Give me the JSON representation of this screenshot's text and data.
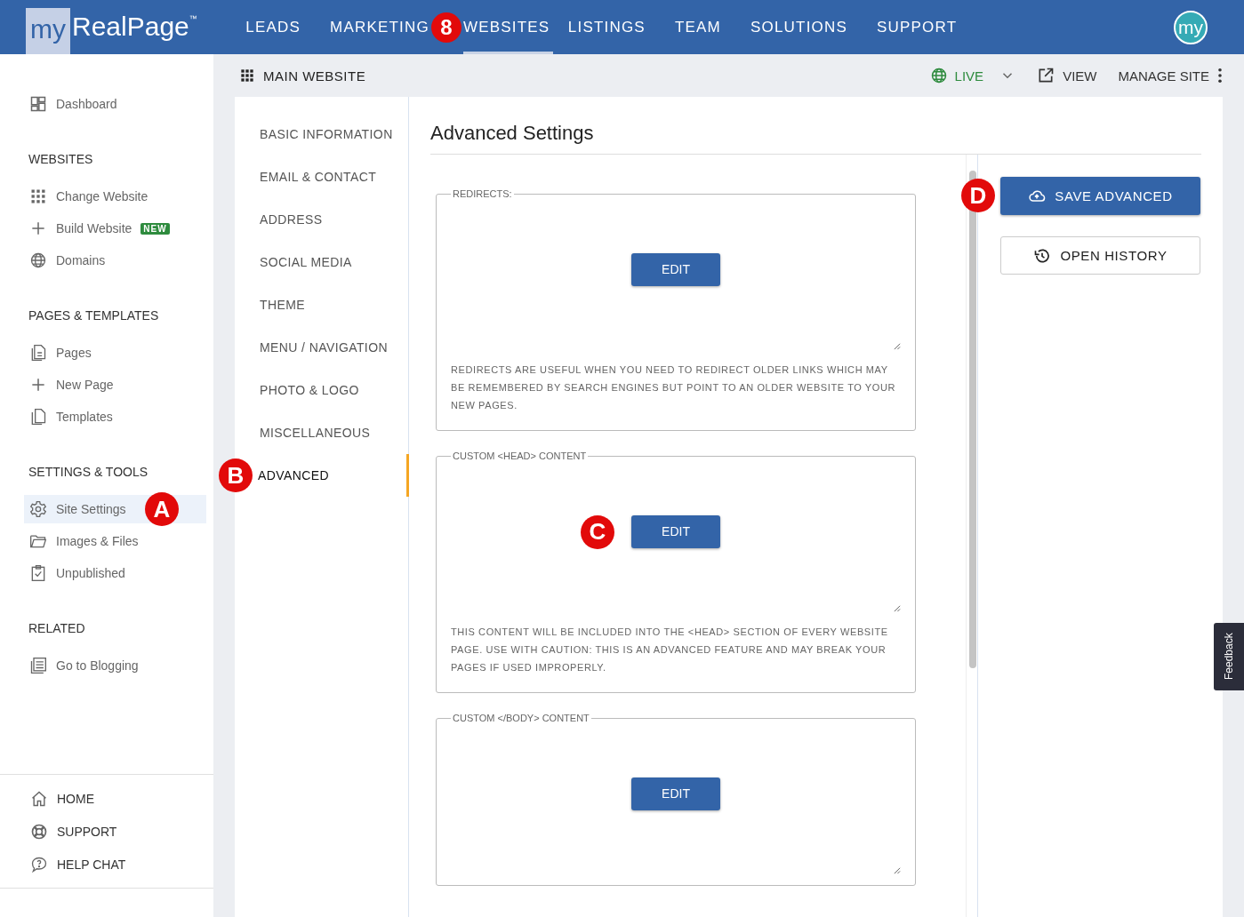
{
  "logo": {
    "prefix": "my",
    "name": "RealPage",
    "mark": "™"
  },
  "top_nav": [
    {
      "label": "LEADS",
      "selected": false
    },
    {
      "label": "MARKETING",
      "selected": false,
      "callout": "8"
    },
    {
      "label": "WEBSITES",
      "selected": true
    },
    {
      "label": "LISTINGS",
      "selected": false
    },
    {
      "label": "TEAM",
      "selected": false
    },
    {
      "label": "SOLUTIONS",
      "selected": false
    },
    {
      "label": "SUPPORT",
      "selected": false
    }
  ],
  "avatar": "my",
  "sidebar": {
    "top": [
      {
        "label": "Dashboard",
        "selected": false
      }
    ],
    "sections": [
      {
        "heading": "WEBSITES",
        "items": [
          {
            "label": "Change Website",
            "selected": false
          },
          {
            "label": "Build Website",
            "selected": false,
            "badge": "NEW"
          },
          {
            "label": "Domains",
            "selected": false
          }
        ]
      },
      {
        "heading": "PAGES & TEMPLATES",
        "items": [
          {
            "label": "Pages",
            "selected": false
          },
          {
            "label": "New Page",
            "selected": false
          },
          {
            "label": "Templates",
            "selected": false
          }
        ]
      },
      {
        "heading": "SETTINGS & TOOLS",
        "items": [
          {
            "label": "Site Settings",
            "selected": true,
            "callout": "A"
          },
          {
            "label": "Images & Files",
            "selected": false
          },
          {
            "label": "Unpublished",
            "selected": false
          }
        ]
      },
      {
        "heading": "RELATED",
        "items": [
          {
            "label": "Go to Blogging",
            "selected": false
          }
        ]
      }
    ],
    "footer": [
      "HOME",
      "SUPPORT",
      "HELP CHAT"
    ]
  },
  "subheader": {
    "title": "MAIN WEBSITE",
    "status": "LIVE",
    "view": "VIEW",
    "manage": "MANAGE SITE"
  },
  "settings_nav": [
    {
      "label": "BASIC INFORMATION",
      "selected": false
    },
    {
      "label": "EMAIL & CONTACT",
      "selected": false
    },
    {
      "label": "ADDRESS",
      "selected": false
    },
    {
      "label": "SOCIAL MEDIA",
      "selected": false
    },
    {
      "label": "THEME",
      "selected": false
    },
    {
      "label": "MENU / NAVIGATION",
      "selected": false
    },
    {
      "label": "PHOTO & LOGO",
      "selected": false
    },
    {
      "label": "MISCELLANEOUS",
      "selected": false
    },
    {
      "label": "ADVANCED",
      "selected": true,
      "callout": "B"
    }
  ],
  "page_title": "Advanced Settings",
  "fields": [
    {
      "legend": "REDIRECTS:",
      "button": "EDIT",
      "description": "REDIRECTS ARE USEFUL WHEN YOU NEED TO REDIRECT OLDER LINKS WHICH MAY BE REMEMBERED BY SEARCH ENGINES BUT POINT TO AN OLDER WEBSITE TO YOUR NEW PAGES."
    },
    {
      "legend": "CUSTOM <HEAD> CONTENT",
      "button": "EDIT",
      "callout": "C",
      "description": "THIS CONTENT WILL BE INCLUDED INTO THE <HEAD> SECTION OF EVERY WEBSITE PAGE. USE WITH CAUTION: THIS IS AN ADVANCED FEATURE AND MAY BREAK YOUR PAGES IF USED IMPROPERLY."
    },
    {
      "legend": "CUSTOM </BODY> CONTENT",
      "button": "EDIT"
    }
  ],
  "actions": [
    {
      "label": "SAVE ADVANCED",
      "kind": "primary",
      "callout": "D"
    },
    {
      "label": "OPEN HISTORY",
      "kind": "secondary"
    }
  ],
  "feedback": "Feedback"
}
